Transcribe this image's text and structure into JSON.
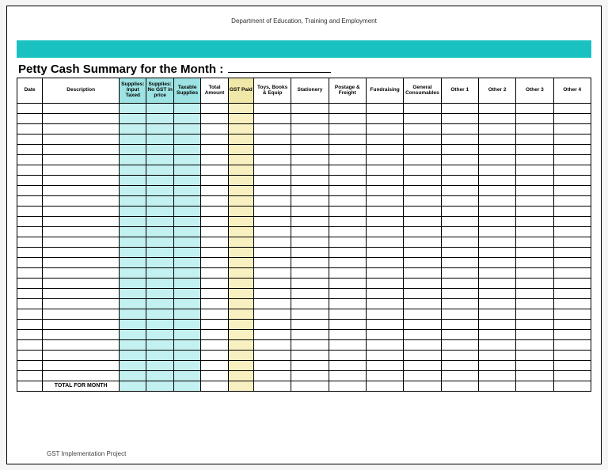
{
  "header": {
    "department": "Department of Education, Training and Employment"
  },
  "title": "Petty Cash Summary for the Month :",
  "month_value": "",
  "columns": {
    "date": "Date",
    "description": "Description",
    "supplies_input_taxed": "Supplies: Input Taxed",
    "supplies_no_gst": "Supplies: No GST in price",
    "taxable_supplies": "Taxable Supplies",
    "total_amount": "Total Amount",
    "gst_paid": "GST Paid",
    "toys_books_equip": "Toys, Books & Equip",
    "stationery": "Stationery",
    "postage_freight": "Postage & Freight",
    "fundraising": "Fundraising",
    "general_consumables": "General Consumables",
    "other1": "Other 1",
    "other2": "Other 2",
    "other3": "Other 3",
    "other4": "Other 4"
  },
  "row_count": 27,
  "total_row_label": "TOTAL FOR MONTH",
  "footer": "GST Implementation Project",
  "colors": {
    "accent_bar": "#19c2c0",
    "supplies_fill": "#c3f0f0",
    "gst_fill": "#f8f0c0"
  }
}
